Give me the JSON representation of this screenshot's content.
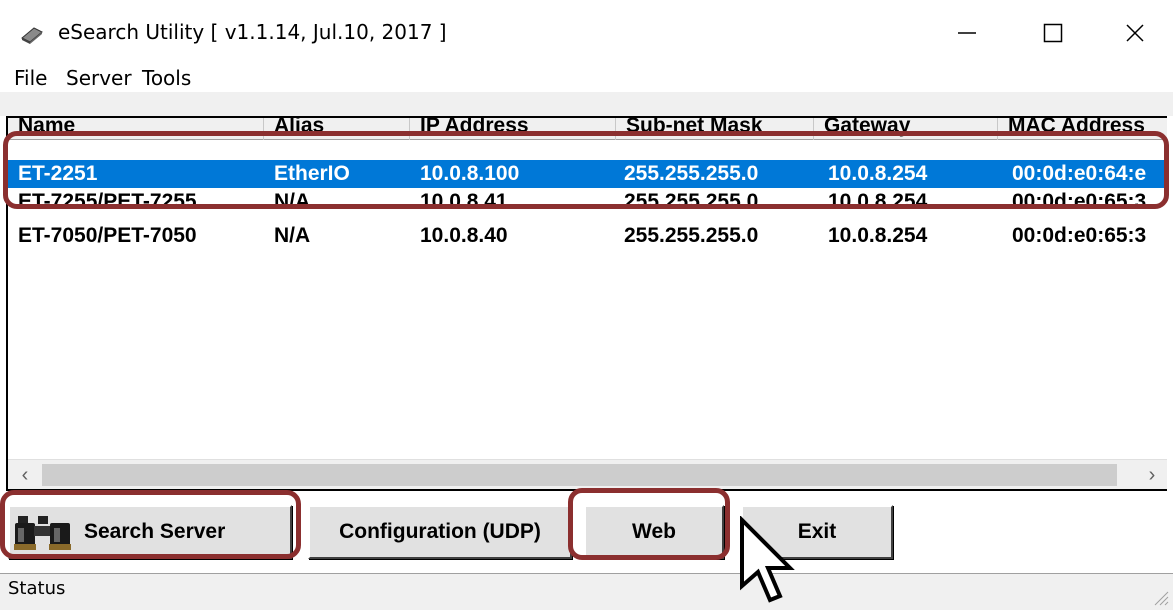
{
  "window": {
    "title": "eSearch Utility [ v1.1.14, Jul.10, 2017 ]"
  },
  "menu": {
    "items": [
      "File",
      "Server",
      "Tools"
    ]
  },
  "table": {
    "columns": [
      "Name",
      "Alias",
      "IP Address",
      "Sub-net Mask",
      "Gateway",
      "MAC Address"
    ],
    "rows": [
      {
        "name": "ET-2251",
        "alias": "EtherIO",
        "ip": "10.0.8.100",
        "mask": "255.255.255.0",
        "gateway": "10.0.8.254",
        "mac": "00:0d:e0:64:e",
        "selected": true
      },
      {
        "name": "ET-7255/PET-7255",
        "alias": "N/A",
        "ip": "10.0.8.41",
        "mask": "255.255.255.0",
        "gateway": "10.0.8.254",
        "mac": "00:0d:e0:65:3",
        "selected": false
      },
      {
        "name": "ET-7050/PET-7050",
        "alias": "N/A",
        "ip": "10.0.8.40",
        "mask": "255.255.255.0",
        "gateway": "10.0.8.254",
        "mac": "00:0d:e0:65:3",
        "selected": false
      }
    ]
  },
  "buttons": {
    "search": "Search Server",
    "config": "Configuration (UDP)",
    "web": "Web",
    "exit": "Exit"
  },
  "status": {
    "text": "Status"
  },
  "colors": {
    "selection": "#0078d7",
    "highlight": "#8b2f2f"
  },
  "icons": {
    "app": "app-icon",
    "search_button": "binoculars-icon",
    "cursor": "mouse-pointer-icon"
  }
}
